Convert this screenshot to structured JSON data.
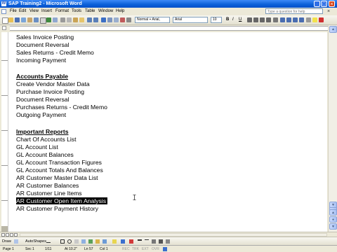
{
  "window": {
    "title": "SAP Training2 - Microsoft Word"
  },
  "menu": {
    "items": [
      "File",
      "Edit",
      "View",
      "Insert",
      "Format",
      "Tools",
      "Table",
      "Window",
      "Help"
    ],
    "help_placeholder": "Type a question for help"
  },
  "toolbar": {
    "style_value": "Normal + Arial,",
    "font_value": "Arial",
    "size_value": "10",
    "bold_label": "B",
    "italic_label": "I",
    "underline_label": "U"
  },
  "document": {
    "lines": [
      {
        "text": "Sales Invoice Posting",
        "style": "normal"
      },
      {
        "text": "Document Reversal",
        "style": "normal"
      },
      {
        "text": "Sales Returns - Credit Memo",
        "style": "normal"
      },
      {
        "text": "Incoming Payment",
        "style": "normal"
      },
      {
        "text": "",
        "style": "blank"
      },
      {
        "text": "Accounts Payable",
        "style": "heading"
      },
      {
        "text": "Create Vendor Master Data",
        "style": "normal"
      },
      {
        "text": "Purchase Invoice Posting",
        "style": "normal"
      },
      {
        "text": "Document Reversal",
        "style": "normal"
      },
      {
        "text": "Purchases Returns - Credit Memo",
        "style": "normal"
      },
      {
        "text": "Outgoing Payment",
        "style": "normal"
      },
      {
        "text": "",
        "style": "blank"
      },
      {
        "text": "Important Reports",
        "style": "heading"
      },
      {
        "text": "Chart Of Accounts List",
        "style": "normal"
      },
      {
        "text": "GL Account List",
        "style": "normal"
      },
      {
        "text": "GL Account Balances",
        "style": "normal"
      },
      {
        "text": "GL Account Transaction Figures",
        "style": "normal"
      },
      {
        "text": "GL Account Totals And Balances",
        "style": "normal"
      },
      {
        "text": "AR Customer Master Data List",
        "style": "normal"
      },
      {
        "text": "AR Customer Balances",
        "style": "normal"
      },
      {
        "text": "AR Customer Line Items",
        "style": "normal"
      },
      {
        "text": "AR Customer Open Item Analysis",
        "style": "selected"
      },
      {
        "text": "AR Customer Payment History",
        "style": "normal"
      }
    ]
  },
  "drawing": {
    "draw_label": "Draw",
    "autoshapes_label": "AutoShapes"
  },
  "status": {
    "page": "Page 1",
    "sec": "Sec 1",
    "pages": "1/11",
    "at": "At 10.2\"",
    "ln": "Ln 57",
    "col": "Col 1",
    "rec": "REC",
    "trk": "TRK",
    "ext": "EXT",
    "ovr": "OVR"
  },
  "colors": {
    "titlebar": "#0a5fd8",
    "selection_bg": "#000000",
    "selection_fg": "#ffffff"
  }
}
